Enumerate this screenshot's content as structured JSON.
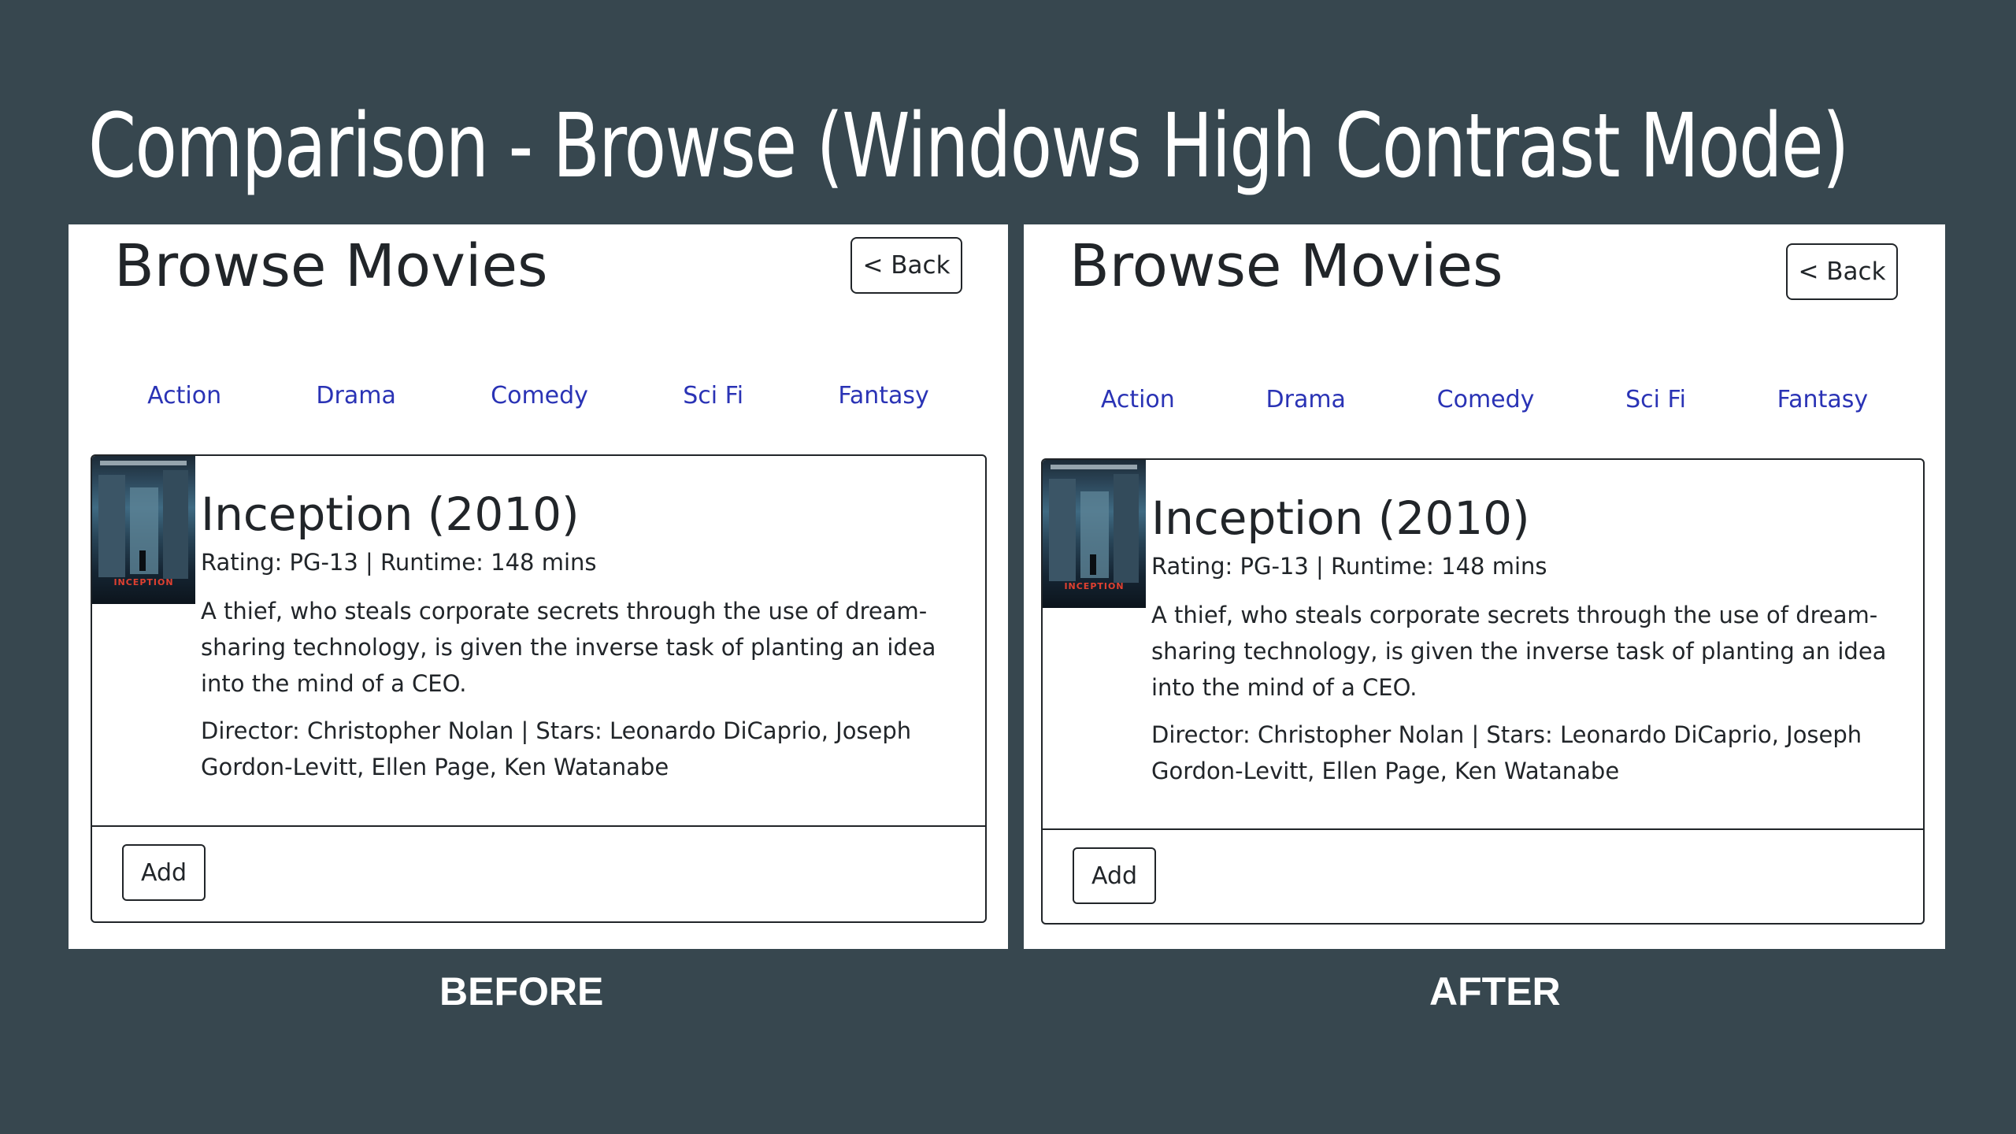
{
  "slide": {
    "title": "Comparison - Browse (Windows High Contrast Mode)"
  },
  "panels": [
    {
      "caption": "BEFORE",
      "heading": "Browse Movies",
      "back_label": "< Back",
      "genres": [
        "Action",
        "Drama",
        "Comedy",
        "Sci Fi",
        "Fantasy"
      ],
      "movie": {
        "poster_text": "INCEPTION",
        "title": "Inception (2010)",
        "meta": "Rating: PG-13 | Runtime: 148 mins",
        "description": "A thief, who steals corporate secrets through the use of dream-sharing technology, is given the inverse task of planting an idea into the mind of a CEO.",
        "credits": "Director: Christopher Nolan | Stars: Leonardo DiCaprio, Joseph Gordon-Levitt, Ellen Page, Ken Watanabe",
        "add_label": "Add"
      }
    },
    {
      "caption": "AFTER",
      "heading": "Browse Movies",
      "back_label": "< Back",
      "genres": [
        "Action",
        "Drama",
        "Comedy",
        "Sci Fi",
        "Fantasy"
      ],
      "movie": {
        "poster_text": "INCEPTION",
        "title": "Inception (2010)",
        "meta": "Rating: PG-13 | Runtime: 148 mins",
        "description": "A thief, who steals corporate secrets through the use of dream-sharing technology, is given the inverse task of planting an idea into the mind of a CEO.",
        "credits": "Director: Christopher Nolan | Stars: Leonardo DiCaprio, Joseph Gordon-Levitt, Ellen Page, Ken Watanabe",
        "add_label": "Add"
      }
    }
  ],
  "colors": {
    "slide_background": "#37474f",
    "link": "#2a33b5",
    "text": "#212529"
  }
}
